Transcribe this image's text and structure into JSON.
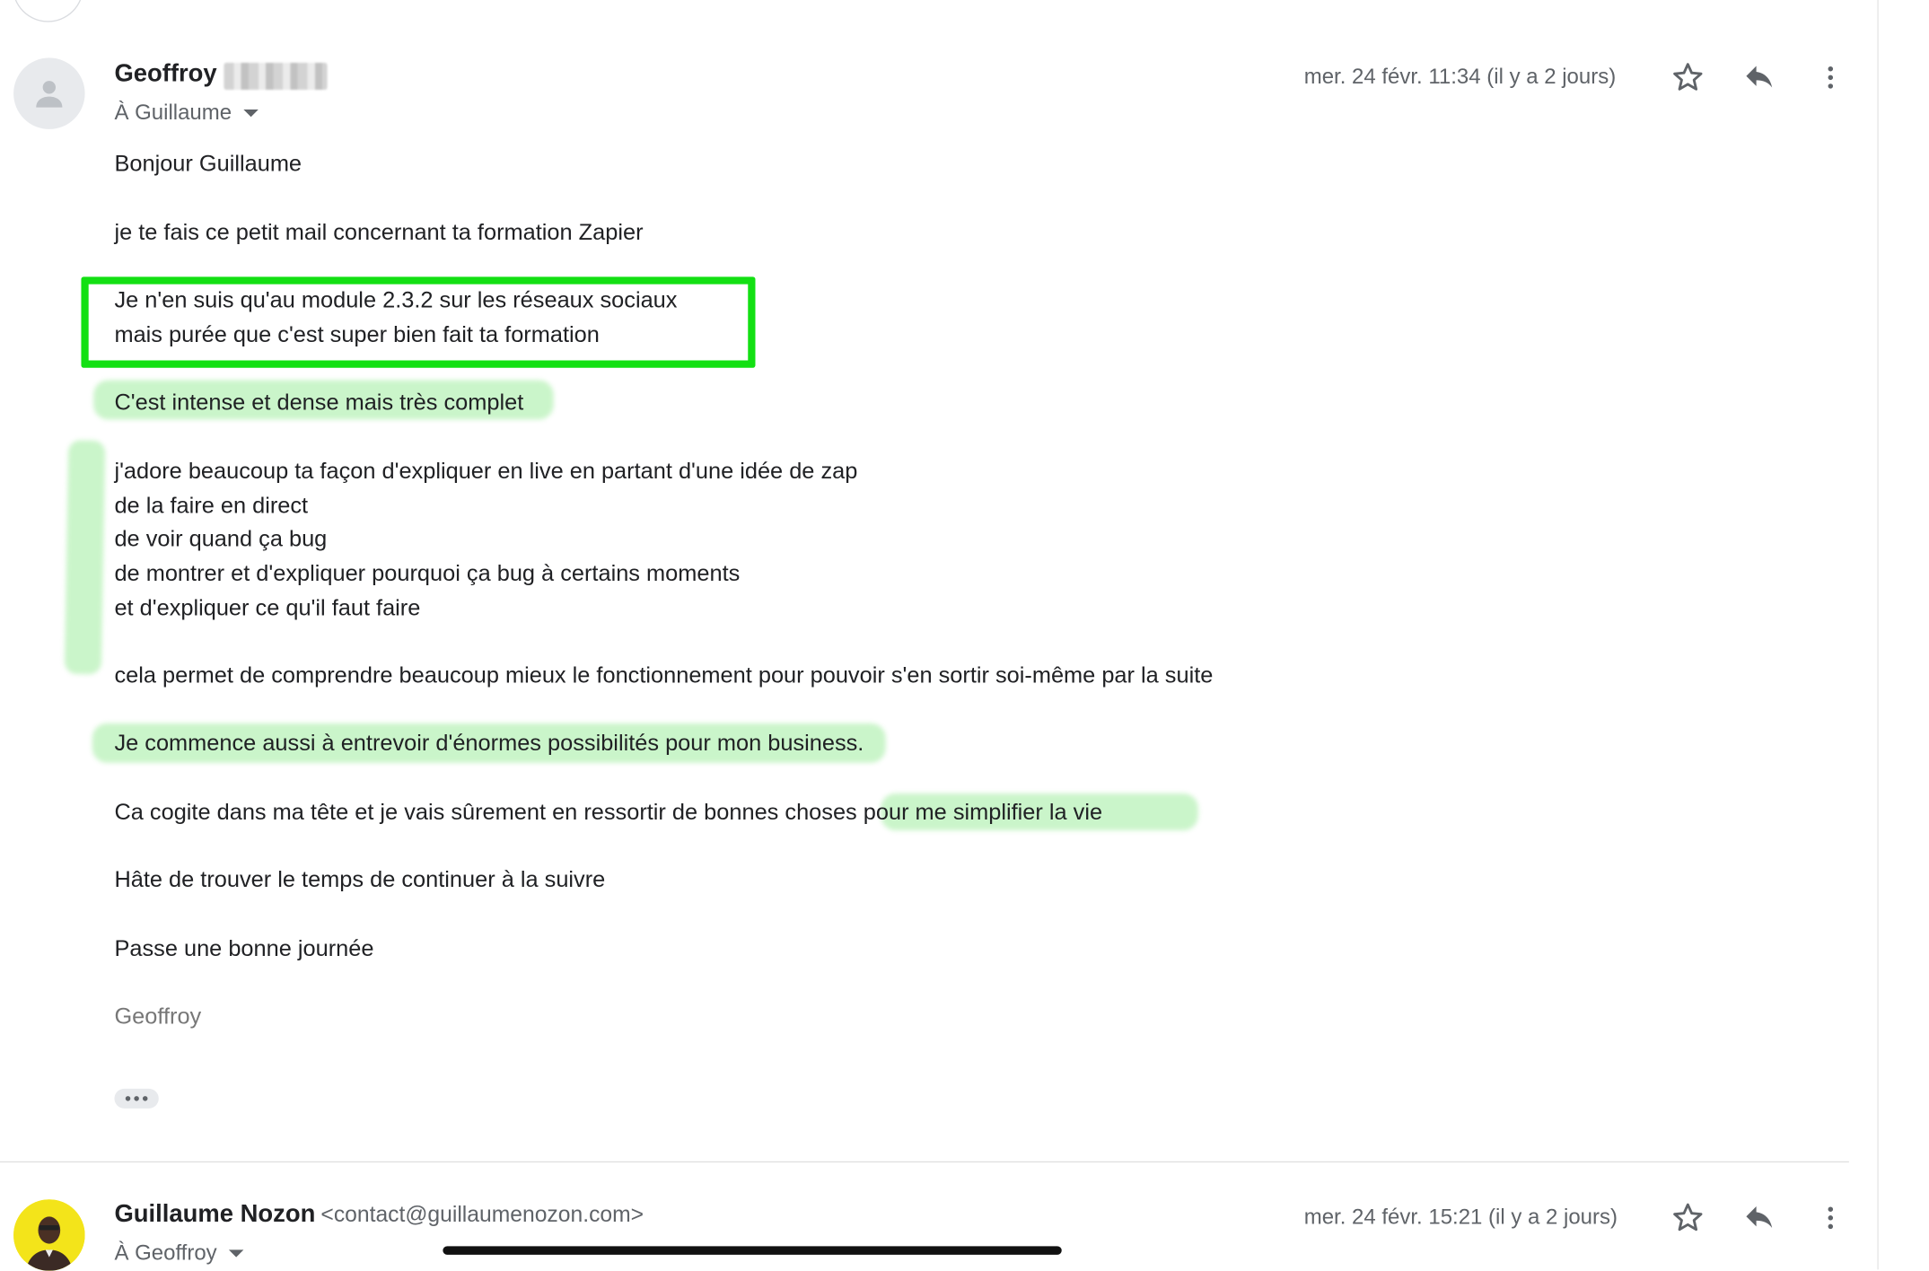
{
  "message1": {
    "sender": "Geoffroy",
    "to_line": "À Guillaume",
    "date": "mer. 24 févr. 11:34 (il y a 2 jours)",
    "body": {
      "greeting": "Bonjour Guillaume",
      "intro": "je te fais ce petit mail concernant ta formation Zapier",
      "module_l1": "Je n'en suis qu'au module 2.3.2  sur les réseaux sociaux",
      "module_l2": "mais purée que c'est super bien fait ta formation",
      "intense": "C'est intense et dense mais très complet",
      "adore_l1": "j'adore beaucoup ta façon d'expliquer en live en partant d'une idée de zap",
      "adore_l2": "de la faire en direct",
      "adore_l3": "de voir quand ça bug",
      "adore_l4": "de montrer et d'expliquer pourquoi ça bug à certains moments",
      "adore_l5": "et d'expliquer ce qu'il faut faire",
      "comprendre": "cela permet de comprendre beaucoup mieux le fonctionnement pour pouvoir s'en sortir soi-même par la suite",
      "business": "Je commence aussi à entrevoir d'énormes possibilités pour mon business.",
      "cogite_a": "Ca cogite dans ma tête et je vais sûrement en ressortir de bonnes choses ",
      "cogite_b": "pour me simplifier la vie",
      "hate": "Hâte de trouver le temps de continuer à la suivre",
      "passe": "Passe une bonne journée",
      "signature": "Geoffroy"
    }
  },
  "message2": {
    "sender": "Guillaume Nozon",
    "email": "<contact@guillaumenozon.com>",
    "to_line": "À Geoffroy",
    "date": "mer. 24 févr. 15:21 (il y a 2 jours)"
  },
  "icons": [
    "person-placeholder-icon",
    "star-icon",
    "reply-icon",
    "more-vert-icon",
    "caret-down-icon",
    "ellipsis-icon"
  ],
  "colors": {
    "highlight_green": "#8be98a",
    "box_green": "#13e013",
    "text": "#202124",
    "muted": "#5f6368"
  }
}
